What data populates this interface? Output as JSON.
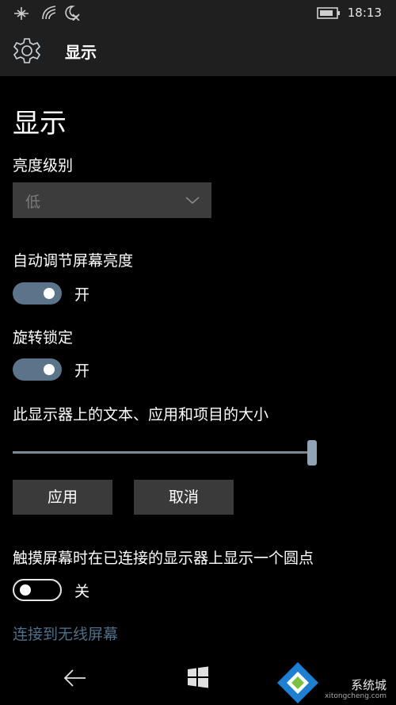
{
  "statusbar": {
    "time": "18:13",
    "icons": [
      "airplane-mode-icon",
      "wifi-icon",
      "quiet-hours-icon",
      "battery-icon"
    ]
  },
  "header": {
    "icon": "gear-icon",
    "title": "显示"
  },
  "page": {
    "title": "显示"
  },
  "brightness": {
    "label": "亮度级别",
    "value": "低",
    "icon": "chevron-down-icon"
  },
  "auto_brightness": {
    "label": "自动调节屏幕亮度",
    "state": "开",
    "on": true
  },
  "rotation_lock": {
    "label": "旋转锁定",
    "state": "开",
    "on": true
  },
  "scale": {
    "label": "此显示器上的文本、应用和项目的大小",
    "value": 1.0
  },
  "buttons": {
    "apply": "应用",
    "cancel": "取消"
  },
  "touch_dot": {
    "label": "触摸屏幕时在已连接的显示器上显示一个圆点",
    "state": "关",
    "on": false
  },
  "wireless_link": {
    "label": "连接到无线屏幕",
    "color": "#4d6f8a"
  },
  "navbar": {
    "icons": [
      "back-icon",
      "windows-start-icon",
      "search-icon"
    ]
  },
  "watermark": {
    "text": "系统城",
    "sub": "xitongcheng.com"
  },
  "colors": {
    "toggle_on": "#5b7489",
    "slider": "#90a4b6",
    "header_bg": "#1f1f1f"
  }
}
